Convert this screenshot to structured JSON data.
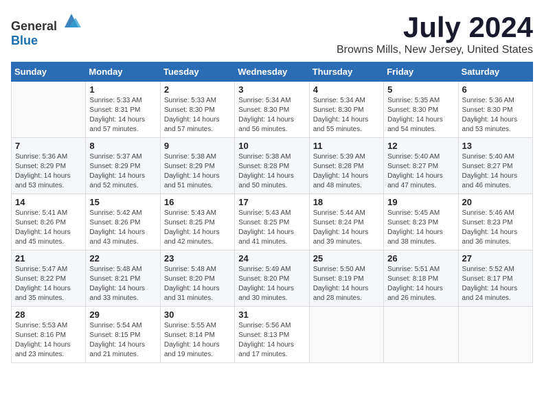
{
  "logo": {
    "text_general": "General",
    "text_blue": "Blue"
  },
  "title": "July 2024",
  "location": "Browns Mills, New Jersey, United States",
  "days_of_week": [
    "Sunday",
    "Monday",
    "Tuesday",
    "Wednesday",
    "Thursday",
    "Friday",
    "Saturday"
  ],
  "weeks": [
    [
      {
        "day": "",
        "info": ""
      },
      {
        "day": "1",
        "info": "Sunrise: 5:33 AM\nSunset: 8:31 PM\nDaylight: 14 hours\nand 57 minutes."
      },
      {
        "day": "2",
        "info": "Sunrise: 5:33 AM\nSunset: 8:30 PM\nDaylight: 14 hours\nand 57 minutes."
      },
      {
        "day": "3",
        "info": "Sunrise: 5:34 AM\nSunset: 8:30 PM\nDaylight: 14 hours\nand 56 minutes."
      },
      {
        "day": "4",
        "info": "Sunrise: 5:34 AM\nSunset: 8:30 PM\nDaylight: 14 hours\nand 55 minutes."
      },
      {
        "day": "5",
        "info": "Sunrise: 5:35 AM\nSunset: 8:30 PM\nDaylight: 14 hours\nand 54 minutes."
      },
      {
        "day": "6",
        "info": "Sunrise: 5:36 AM\nSunset: 8:30 PM\nDaylight: 14 hours\nand 53 minutes."
      }
    ],
    [
      {
        "day": "7",
        "info": "Sunrise: 5:36 AM\nSunset: 8:29 PM\nDaylight: 14 hours\nand 53 minutes."
      },
      {
        "day": "8",
        "info": "Sunrise: 5:37 AM\nSunset: 8:29 PM\nDaylight: 14 hours\nand 52 minutes."
      },
      {
        "day": "9",
        "info": "Sunrise: 5:38 AM\nSunset: 8:29 PM\nDaylight: 14 hours\nand 51 minutes."
      },
      {
        "day": "10",
        "info": "Sunrise: 5:38 AM\nSunset: 8:28 PM\nDaylight: 14 hours\nand 50 minutes."
      },
      {
        "day": "11",
        "info": "Sunrise: 5:39 AM\nSunset: 8:28 PM\nDaylight: 14 hours\nand 48 minutes."
      },
      {
        "day": "12",
        "info": "Sunrise: 5:40 AM\nSunset: 8:27 PM\nDaylight: 14 hours\nand 47 minutes."
      },
      {
        "day": "13",
        "info": "Sunrise: 5:40 AM\nSunset: 8:27 PM\nDaylight: 14 hours\nand 46 minutes."
      }
    ],
    [
      {
        "day": "14",
        "info": "Sunrise: 5:41 AM\nSunset: 8:26 PM\nDaylight: 14 hours\nand 45 minutes."
      },
      {
        "day": "15",
        "info": "Sunrise: 5:42 AM\nSunset: 8:26 PM\nDaylight: 14 hours\nand 43 minutes."
      },
      {
        "day": "16",
        "info": "Sunrise: 5:43 AM\nSunset: 8:25 PM\nDaylight: 14 hours\nand 42 minutes."
      },
      {
        "day": "17",
        "info": "Sunrise: 5:43 AM\nSunset: 8:25 PM\nDaylight: 14 hours\nand 41 minutes."
      },
      {
        "day": "18",
        "info": "Sunrise: 5:44 AM\nSunset: 8:24 PM\nDaylight: 14 hours\nand 39 minutes."
      },
      {
        "day": "19",
        "info": "Sunrise: 5:45 AM\nSunset: 8:23 PM\nDaylight: 14 hours\nand 38 minutes."
      },
      {
        "day": "20",
        "info": "Sunrise: 5:46 AM\nSunset: 8:23 PM\nDaylight: 14 hours\nand 36 minutes."
      }
    ],
    [
      {
        "day": "21",
        "info": "Sunrise: 5:47 AM\nSunset: 8:22 PM\nDaylight: 14 hours\nand 35 minutes."
      },
      {
        "day": "22",
        "info": "Sunrise: 5:48 AM\nSunset: 8:21 PM\nDaylight: 14 hours\nand 33 minutes."
      },
      {
        "day": "23",
        "info": "Sunrise: 5:48 AM\nSunset: 8:20 PM\nDaylight: 14 hours\nand 31 minutes."
      },
      {
        "day": "24",
        "info": "Sunrise: 5:49 AM\nSunset: 8:20 PM\nDaylight: 14 hours\nand 30 minutes."
      },
      {
        "day": "25",
        "info": "Sunrise: 5:50 AM\nSunset: 8:19 PM\nDaylight: 14 hours\nand 28 minutes."
      },
      {
        "day": "26",
        "info": "Sunrise: 5:51 AM\nSunset: 8:18 PM\nDaylight: 14 hours\nand 26 minutes."
      },
      {
        "day": "27",
        "info": "Sunrise: 5:52 AM\nSunset: 8:17 PM\nDaylight: 14 hours\nand 24 minutes."
      }
    ],
    [
      {
        "day": "28",
        "info": "Sunrise: 5:53 AM\nSunset: 8:16 PM\nDaylight: 14 hours\nand 23 minutes."
      },
      {
        "day": "29",
        "info": "Sunrise: 5:54 AM\nSunset: 8:15 PM\nDaylight: 14 hours\nand 21 minutes."
      },
      {
        "day": "30",
        "info": "Sunrise: 5:55 AM\nSunset: 8:14 PM\nDaylight: 14 hours\nand 19 minutes."
      },
      {
        "day": "31",
        "info": "Sunrise: 5:56 AM\nSunset: 8:13 PM\nDaylight: 14 hours\nand 17 minutes."
      },
      {
        "day": "",
        "info": ""
      },
      {
        "day": "",
        "info": ""
      },
      {
        "day": "",
        "info": ""
      }
    ]
  ]
}
